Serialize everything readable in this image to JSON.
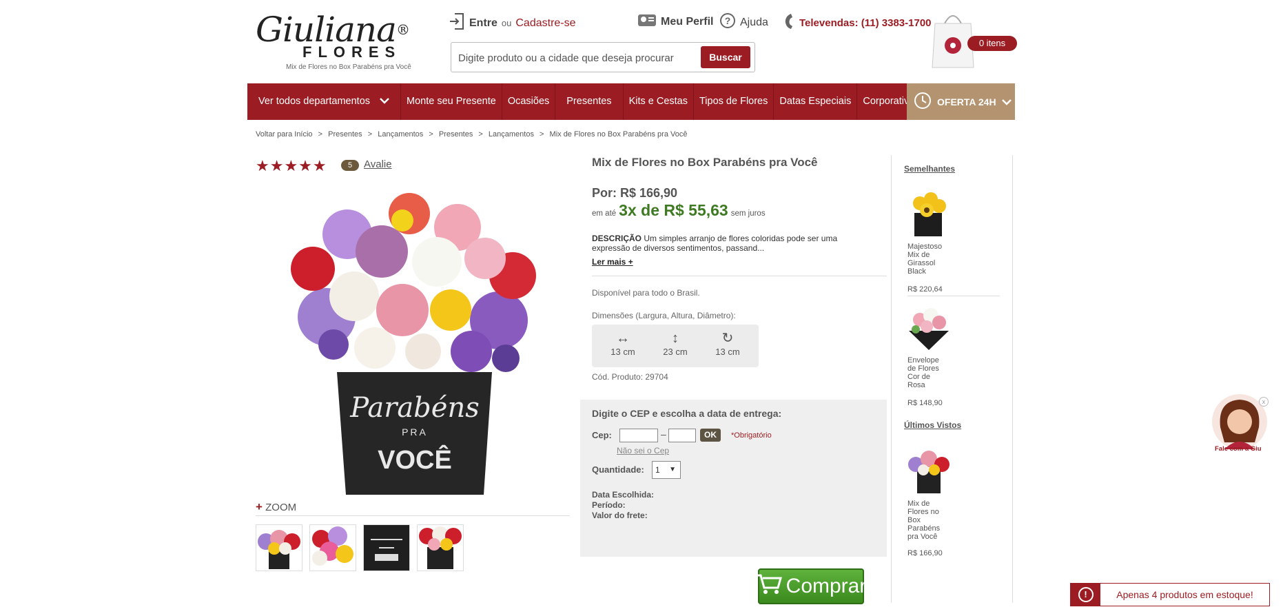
{
  "header": {
    "brand": "Giuliana",
    "brand_reg": "®",
    "brand_sub": "FLORES",
    "brand_tagline": "Mix de Flores no Box Parabéns pra Você",
    "login_label": "Entre",
    "or_label": "ou",
    "signup_label": "Cadastre-se",
    "profile_label": "Meu Perfil",
    "help_label": "Ajuda",
    "phone_label": "Televendas: (11) 3383-1700",
    "search_placeholder": "Digite produto ou a cidade que deseja procurar",
    "search_button": "Buscar",
    "cart_label": "0 itens"
  },
  "nav": {
    "items": [
      "Ver todos departamentos",
      "Monte seu Presente",
      "Ocasiões",
      "Presentes",
      "Kits e Cestas",
      "Tipos de Flores",
      "Datas Especiais",
      "Corporativo"
    ],
    "offer": "OFERTA 24H"
  },
  "breadcrumb": [
    "Voltar para Início",
    ">",
    "Presentes",
    ">",
    "Lançamentos",
    ">",
    "Presentes",
    ">",
    "Lançamentos",
    ">",
    "Mix de Flores no Box Parabéns pra Você"
  ],
  "rating": {
    "stars": "★★★★★",
    "count": "5",
    "link": "Avalie"
  },
  "gallery": {
    "zoom_plus": "+",
    "zoom_label": "ZOOM",
    "box_text_1": "Parabéns",
    "box_text_2": "PRA",
    "box_text_3": "VOCÊ"
  },
  "product": {
    "title": "Mix de Flores no Box Parabéns pra Você",
    "price": "Por: R$ 166,90",
    "install_prefix": "em até",
    "install_value": "3x de R$ 55,63",
    "install_suffix": "sem juros",
    "desc_label": "DESCRIÇÃO",
    "desc_text": " Um simples arranjo de flores coloridas pode ser uma expressão de diversos sentimentos, passand...",
    "read_more": "Ler mais +",
    "availability": "Disponível para todo o Brasil.",
    "dims_label": "Dimensões (Largura, Altura, Diâmetro):",
    "dims": [
      {
        "icon": "↔",
        "value": "13 cm"
      },
      {
        "icon": "↕",
        "value": "23 cm"
      },
      {
        "icon": "↻",
        "value": "13 cm"
      }
    ],
    "code": "Cód. Produto: 29704"
  },
  "delivery": {
    "heading": "Digite o CEP e escolha a data de entrega:",
    "cep_label": "Cep:",
    "cep_dash": "–",
    "ok": "OK",
    "required": "*Obrigatório",
    "dont_know": "Não sei o Cep",
    "qty_label": "Quantidade:",
    "qty_value": "1",
    "qty_arrow": "▼",
    "date_label": "Data Escolhida:",
    "period_label": "Período:",
    "freight_label": "Valor do frete:",
    "buy_label": "Comprar"
  },
  "sidebar": {
    "similar_heading": "Semelhantes",
    "similar": [
      {
        "name": "Majestoso Mix de Girassol Black",
        "price": "R$ 220,64"
      },
      {
        "name": "Envelope de Flores Cor de Rosa",
        "price": "R$ 148,90"
      }
    ],
    "recent_heading": "Últimos Vistos",
    "recent": [
      {
        "name": "Mix de Flores no Box Parabéns pra Você",
        "price": "R$ 166,90"
      }
    ]
  },
  "chat": {
    "label": "Fale com a Giu",
    "close": "x"
  },
  "stock_alert": {
    "icon": "!",
    "text": "Apenas 4 produtos em estoque!"
  },
  "colors": {
    "brand_red": "#9b1c22",
    "green": "#3d7a21",
    "offer_tan": "#b49470"
  }
}
